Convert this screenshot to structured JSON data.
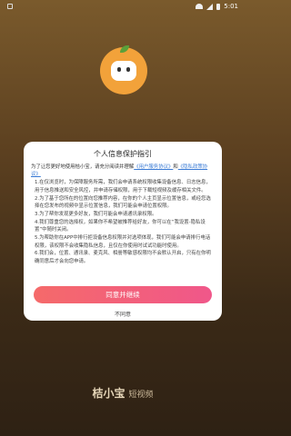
{
  "status_bar": {
    "time": "5:01"
  },
  "dialog": {
    "title": "个人信息保护指引",
    "intro_prefix": "为了让您更好地使用桔小宝，请充分阅读并理解",
    "link_user_agreement": "《用户服务协议》",
    "intro_and": "和",
    "link_privacy": "《隐私政策协议》",
    "paragraphs": [
      "1.在仅浏览时，为保障服务所需，我们会申请系统权限收集设备信息、日志信息，用于信息推送和安全风控，并申请存储权限，用于下载短视频及缓存相关文件。",
      "2.为了基于您所在的位置向您推荐内容，在你的个人主页显示位置信息，或经您选择在您发布的视频中显示位置信息，我们可能会申请位置权限。",
      "3.为了帮你发现更多好友，我们可能会申请通讯录权限。",
      "4.我们尊重您的选择权，如果你不希望被推荐给好友，你可以在“我设置-隐私设置”中随时关闭。",
      "5.为帮助你在APP中排行拒设备信息权限并对选项体现，我们可能会申请排行电话权限，该权限不会收集隐私信息，且仅在你使用时试试功能时使用。",
      "6.我们会，位置、通讯录、麦克风、相册等敏感权限均不会默认开启，只有在你明确同意后才会向您申请。"
    ],
    "agree_label": "同意并继续",
    "disagree_label": "不同意"
  },
  "brand": {
    "name": "桔小宝",
    "sub": "短视频"
  },
  "colors": {
    "accent_gradient_start": "#f56a6a",
    "accent_gradient_end": "#f0578a",
    "link": "#3a7bd5",
    "background_top": "#7a5a2c",
    "background_bottom": "#2e2114"
  }
}
